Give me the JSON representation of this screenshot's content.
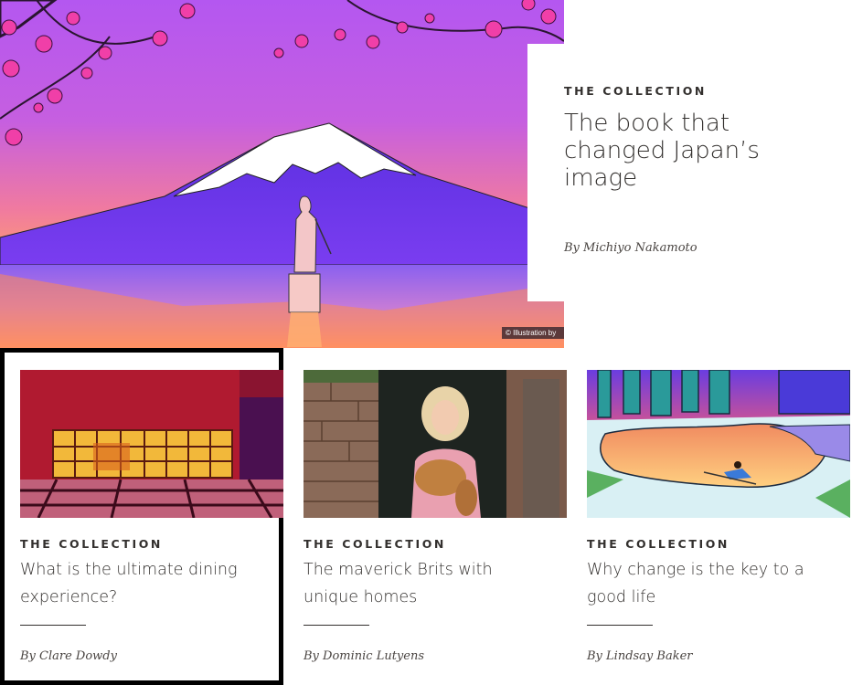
{
  "hero": {
    "kicker": "THE COLLECTION",
    "title": "The book that changed Japan’s image",
    "byline": "By Michiyo Nakamoto",
    "image_credit": "© Illustration by",
    "image_icon": "mount-fuji-illustration"
  },
  "cards": [
    {
      "kicker": "THE COLLECTION",
      "title": "What is the ultimate dining experience?",
      "byline": "By Clare Dowdy",
      "image_icon": "dining-room-image"
    },
    {
      "kicker": "THE COLLECTION",
      "title": "The maverick Brits with unique homes",
      "byline": "By Dominic Lutyens",
      "image_icon": "woman-with-dog-image"
    },
    {
      "kicker": "THE COLLECTION",
      "title": "Why change is the key to a good life",
      "byline": "By Lindsay Baker",
      "image_icon": "skier-landscape-illustration"
    }
  ],
  "colors": {
    "text": "#33302e",
    "selection_border": "#000000",
    "background": "#ffffff"
  }
}
